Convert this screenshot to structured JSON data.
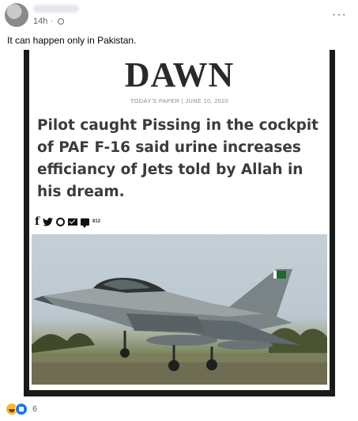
{
  "post": {
    "time": "14h",
    "dot": "·",
    "more": "···",
    "caption": "It can happen only in Pakistan."
  },
  "article": {
    "publication": "DAWN",
    "dateline": "TODAY'S PAPER | JUNE 10, 2020",
    "headline": "Pilot caught Pissing in the cockpit of PAF F-16 said urine increases efficiancy of Jets told by Allah in his dream.",
    "share": {
      "facebook": "f",
      "twitter": "🐦",
      "comments": "812"
    }
  },
  "reactions": {
    "types": [
      "haha",
      "like"
    ],
    "count": "6"
  }
}
